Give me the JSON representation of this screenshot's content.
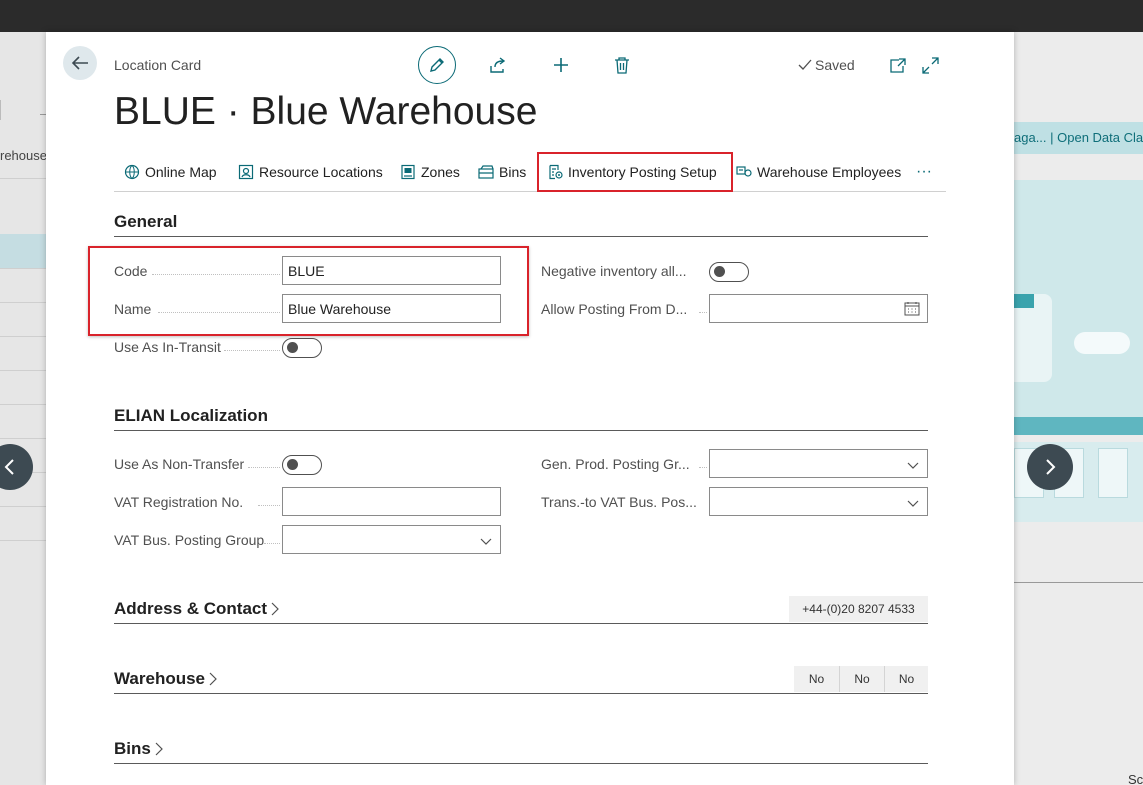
{
  "background": {
    "left_text": "rehouse",
    "right_link_text": "aga... | Open Data Cla",
    "right_bottom_text": "Sc"
  },
  "header": {
    "breadcrumb": "Location Card",
    "saved_label": "Saved",
    "title": "BLUE · Blue Warehouse"
  },
  "actions": [
    {
      "label": "Online Map",
      "icon": "globe-icon"
    },
    {
      "label": "Resource Locations",
      "icon": "resource-location-icon"
    },
    {
      "label": "Zones",
      "icon": "zones-icon"
    },
    {
      "label": "Bins",
      "icon": "bins-icon"
    },
    {
      "label": "Inventory Posting Setup",
      "icon": "inventory-setup-icon"
    },
    {
      "label": "Warehouse Employees",
      "icon": "employees-icon"
    }
  ],
  "more_actions": "···",
  "general": {
    "title": "General",
    "code_label": "Code",
    "code_value": "BLUE",
    "name_label": "Name",
    "name_value": "Blue Warehouse",
    "in_transit_label": "Use As In-Transit",
    "in_transit_value": "off",
    "neg_inv_label": "Negative inventory all...",
    "neg_inv_value": "off",
    "allow_posting_label": "Allow Posting From D...",
    "allow_posting_value": ""
  },
  "localization": {
    "title": "ELIAN Localization",
    "non_transfer_label": "Use As Non-Transfer",
    "non_transfer_value": "off",
    "vat_reg_label": "VAT Registration No.",
    "vat_reg_value": "",
    "vat_bus_label": "VAT Bus. Posting Group",
    "vat_bus_value": "",
    "gen_prod_label": "Gen. Prod. Posting Gr...",
    "gen_prod_value": "",
    "trans_vat_label": "Trans.-to VAT Bus. Pos...",
    "trans_vat_value": ""
  },
  "address": {
    "title": "Address & Contact",
    "phone": "+44-(0)20 8207 4533"
  },
  "warehouse": {
    "title": "Warehouse",
    "values": [
      "No",
      "No",
      "No"
    ]
  },
  "bins": {
    "title": "Bins"
  },
  "colors": {
    "accent": "#0b6a76",
    "highlight_border": "#d9232b",
    "top_bar": "#2b2b2b"
  }
}
